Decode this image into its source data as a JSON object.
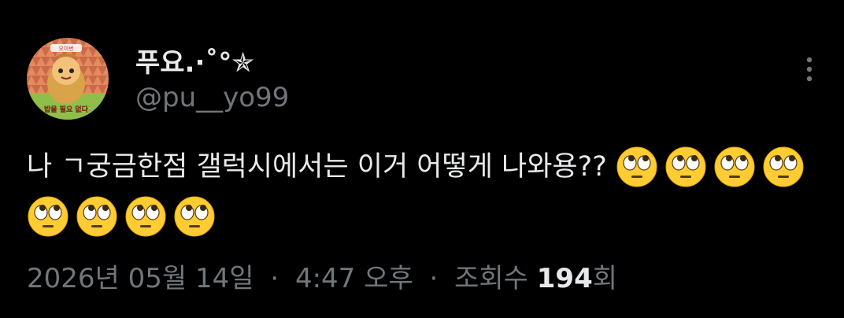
{
  "author": {
    "display_name": "푸요.⋅˚°✯",
    "handle": "@pu__yo99",
    "avatar_caption": "밥을 필요 없다!",
    "avatar_badge": "오이번"
  },
  "tweet": {
    "text": "나 ㄱ궁금한점 갤럭시에서는 이거 어떻게 나와용??",
    "emoji_name": "face-with-rolling-eyes-emoji",
    "emoji_count": 8
  },
  "meta": {
    "date": "2026년 05월 14일",
    "time": "4:47 오후",
    "separator": "·",
    "views_label": "조회수",
    "views_count": "194",
    "views_suffix": "회"
  },
  "colors": {
    "background": "#000000",
    "primary_text": "#e7e9ea",
    "secondary_text": "#71767b",
    "emoji_face": "#ffcc33"
  },
  "icons": {
    "more": "more-dots-icon"
  }
}
